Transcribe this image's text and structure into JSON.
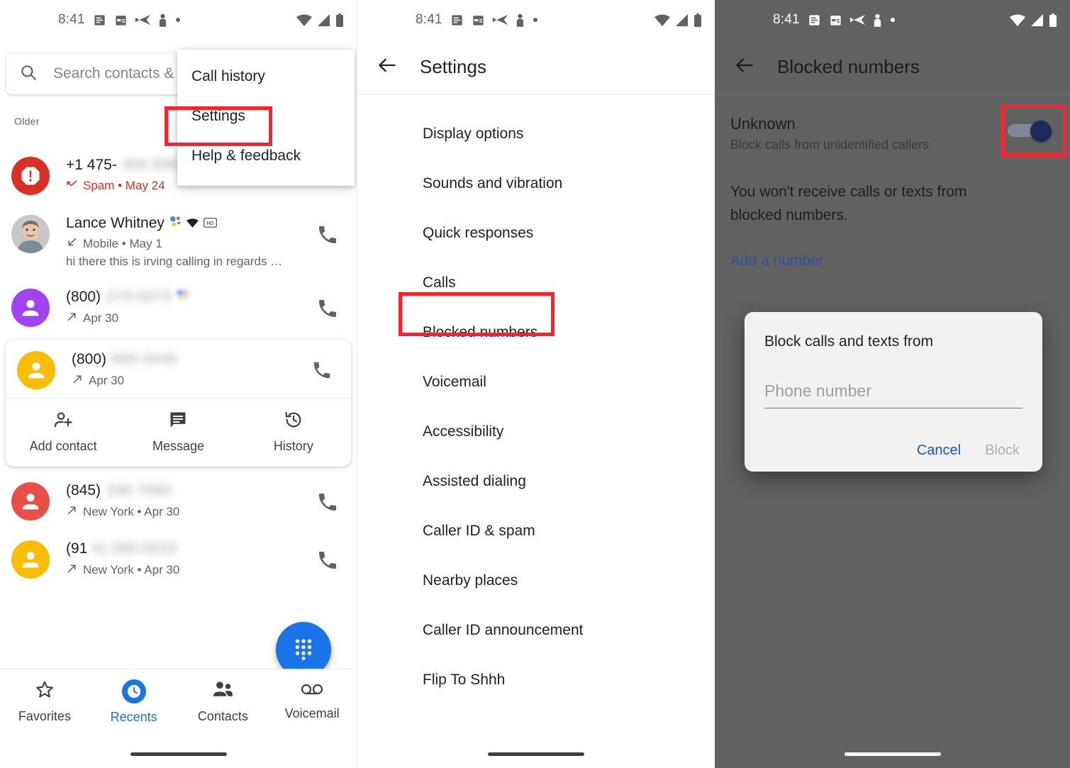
{
  "status_bar": {
    "time": "8:41",
    "left_icons": [
      "notes-icon",
      "calendar-icon",
      "send-icon",
      "person-notification-icon",
      "dot-icon"
    ],
    "right_icons": [
      "wifi-icon",
      "cell-signal-icon",
      "battery-icon"
    ]
  },
  "panel1": {
    "name": "phone-recents-screen",
    "search": {
      "placeholder": "Search contacts &",
      "icon": "search-icon"
    },
    "section_label": "Older",
    "overflow_menu": {
      "items": [
        "Call history",
        "Settings",
        "Help & feedback"
      ],
      "highlighted": "Settings"
    },
    "calls": [
      {
        "title": "+1 475-",
        "title_blurred": "404 8909",
        "subtitle": "Spam • May 24",
        "spam": true,
        "avatar": "spam-warning-icon",
        "avatar_color": "#d93025",
        "direction_icon": "missed-call-icon",
        "call_action": "call-icon"
      },
      {
        "title": "Lance Whitney",
        "title_blurred": "",
        "subtitle": "Mobile • May 1",
        "snippet": "hi there this is irving calling in regards …",
        "spam": false,
        "avatar": "contact-photo",
        "avatar_color": "#bdbdbd",
        "badges": [
          "google-assistant-icon",
          "wifi-call-icon",
          "hd-icon"
        ],
        "direction_icon": "incoming-call-icon",
        "call_action": "call-icon"
      },
      {
        "title": "(800)",
        "title_blurred": "279-0073",
        "subtitle": "Apr 30",
        "spam": false,
        "avatar": "person-icon",
        "avatar_color": "#a142f4",
        "badges": [
          "google-assistant-icon"
        ],
        "direction_icon": "outgoing-call-icon",
        "call_action": "call-icon"
      },
      {
        "title": "(800)",
        "title_blurred": "800-3446",
        "subtitle": "Apr 30",
        "spam": false,
        "expanded": true,
        "avatar": "person-icon",
        "avatar_color": "#fbbc04",
        "direction_icon": "outgoing-call-icon",
        "call_action": "call-icon",
        "actions": [
          {
            "label": "Add contact",
            "icon": "add-contact-icon"
          },
          {
            "label": "Message",
            "icon": "message-icon"
          },
          {
            "label": "History",
            "icon": "history-icon"
          }
        ]
      },
      {
        "title": "(845)",
        "title_blurred": "336-7890",
        "subtitle": "New York • Apr 30",
        "spam": false,
        "avatar": "person-icon",
        "avatar_color": "#ea4f47",
        "direction_icon": "outgoing-call-icon",
        "call_action": "call-icon"
      },
      {
        "title": "(91",
        "title_blurred": "4) 390-0033",
        "subtitle": "New York • Apr 30",
        "spam": false,
        "avatar": "person-icon",
        "avatar_color": "#fbbc04",
        "direction_icon": "outgoing-call-icon",
        "call_action": "call-icon"
      }
    ],
    "fab": {
      "icon": "dialpad-icon",
      "color": "#1a73e8"
    },
    "bottom_nav": {
      "items": [
        {
          "label": "Favorites",
          "icon": "star-icon",
          "active": false
        },
        {
          "label": "Recents",
          "icon": "clock-icon",
          "active": true
        },
        {
          "label": "Contacts",
          "icon": "people-icon",
          "active": false
        },
        {
          "label": "Voicemail",
          "icon": "voicemail-icon",
          "active": false
        }
      ],
      "active_color": "#1a73e8"
    }
  },
  "panel2": {
    "name": "settings-screen",
    "back_icon": "back-arrow-icon",
    "title": "Settings",
    "items": [
      "Display options",
      "Sounds and vibration",
      "Quick responses",
      "Calls",
      "Blocked numbers",
      "Voicemail",
      "Accessibility",
      "Assisted dialing",
      "Caller ID & spam",
      "Nearby places",
      "Caller ID announcement",
      "Flip To Shhh"
    ],
    "highlighted": "Blocked numbers"
  },
  "panel3": {
    "name": "blocked-numbers-screen",
    "back_icon": "back-arrow-icon",
    "title": "Blocked numbers",
    "unknown": {
      "title": "Unknown",
      "subtitle": "Block calls from unidentified callers",
      "toggle_on": true,
      "toggle_color": "#1b2b5a"
    },
    "note": "You won't receive calls or texts from blocked numbers.",
    "add_number_link": "Add a number",
    "dialog": {
      "title": "Block calls and texts from",
      "input_placeholder": "Phone number",
      "input_value": "",
      "cancel_label": "Cancel",
      "block_label": "Block",
      "cancel_color": "#1a56c4",
      "block_color": "#b0b0b0"
    }
  },
  "highlight_color": "#f8232b"
}
